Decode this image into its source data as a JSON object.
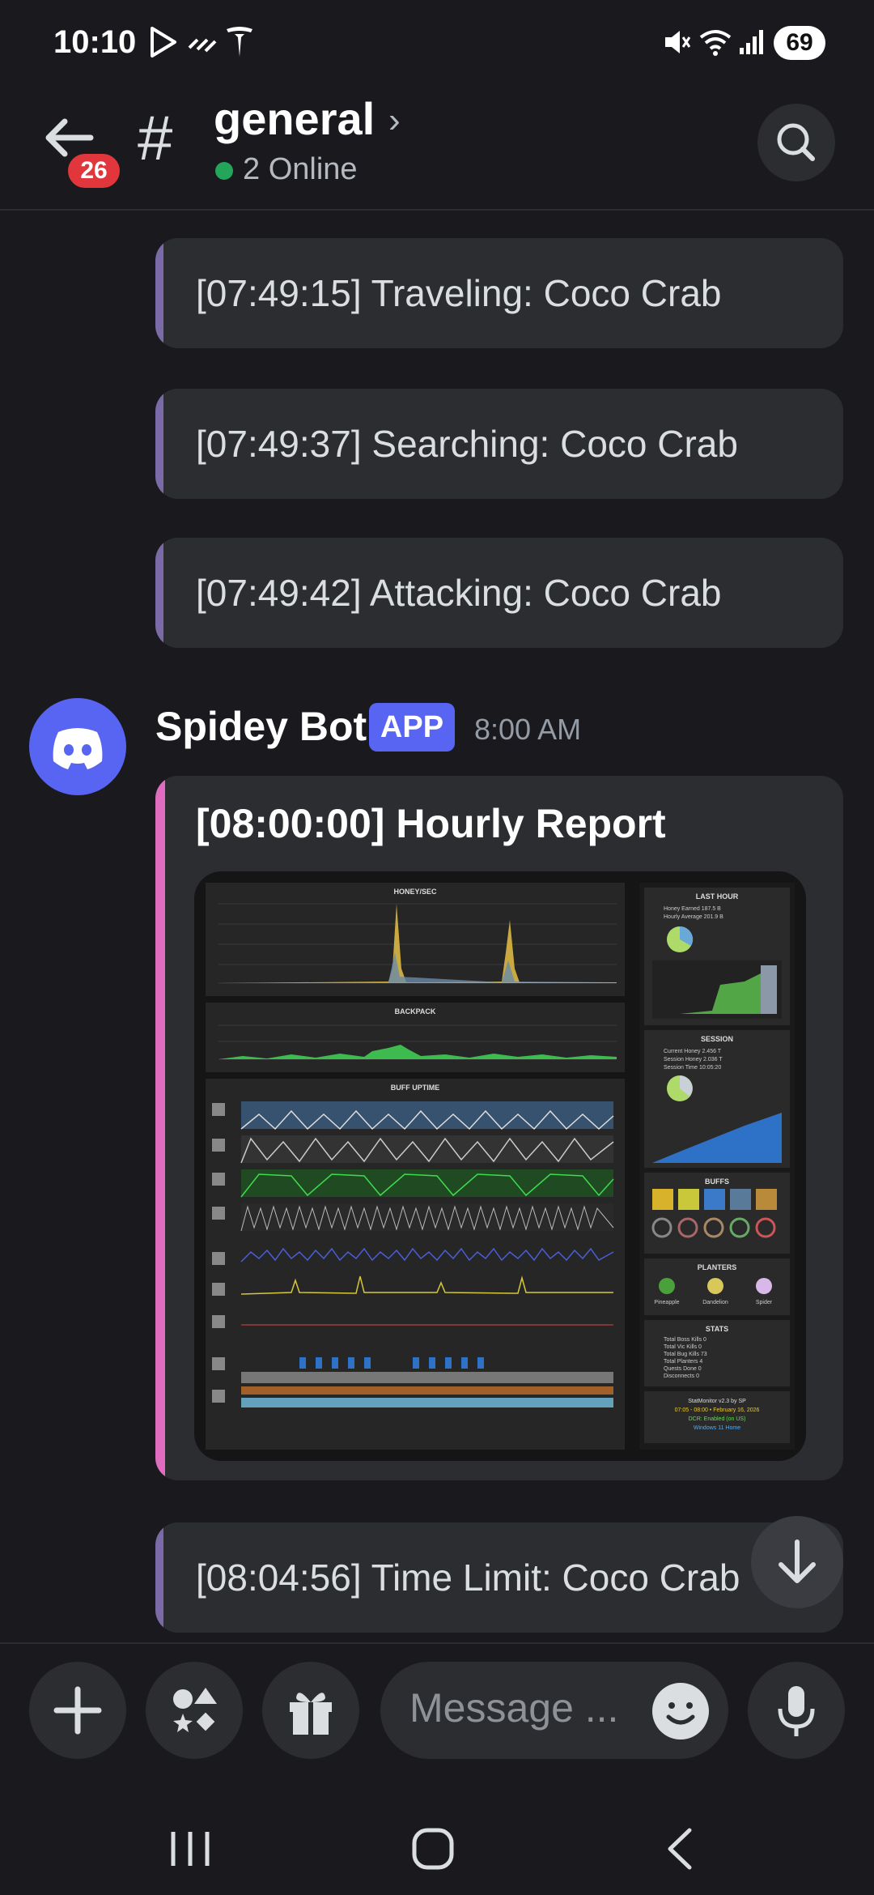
{
  "status_bar": {
    "time": "10:10",
    "battery": "69"
  },
  "header": {
    "unread_count": "26",
    "channel_name": "general",
    "online_status": "2 Online"
  },
  "messages": [
    {
      "text": "[07:49:15] Traveling: Coco Crab"
    },
    {
      "text": "[07:49:37] Searching: Coco Crab"
    },
    {
      "text": "[07:49:42] Attacking: Coco Crab"
    }
  ],
  "bot_message": {
    "author": "Spidey Bot",
    "badge": "APP",
    "time": "8:00 AM",
    "embed_title": "[08:00:00] Hourly Report"
  },
  "report_image": {
    "honey_title": "HONEY/SEC",
    "backpack_title": "BACKPACK",
    "buff_title": "BUFF UPTIME",
    "last_hour_title": "LAST HOUR",
    "session_title": "SESSION",
    "buffs_title": "BUFFS",
    "planters_title": "PLANTERS",
    "stats_title": "STATS",
    "last_hour_lines": [
      "Honey Earned  187.5 B",
      "Hourly Average  201.9 B"
    ],
    "session_lines": [
      "Current Honey  2.456 T",
      "Session Honey  2.036 T",
      "Session Time  10:05:20"
    ],
    "planters": [
      "Pineapple",
      "Dandelion",
      "Spider"
    ],
    "stats_lines": [
      "Total Boss Kills  0",
      "Total Vic Kills  0",
      "Total Bug Kills  73",
      "Total Planters  4",
      "Quests Done  0",
      "Disconnects  0"
    ],
    "footer_lines": [
      "StatMonitor v2.3 by SP",
      "07:05 - 08:00 • February 16, 2026",
      "DCR: Enabled (on US)",
      "Windows 11 Home"
    ]
  },
  "last_message": {
    "text": "[08:04:56] Time Limit: Coco Crab"
  },
  "composer": {
    "placeholder": "Message ..."
  },
  "colors": {
    "accent": "#5865f2",
    "embed_bar": "#e06cc0",
    "online": "#23a55a",
    "badge": "#e0363c"
  }
}
